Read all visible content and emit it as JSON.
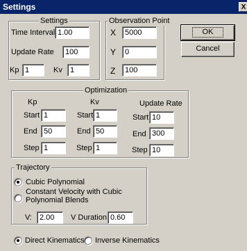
{
  "window": {
    "title": "Settings",
    "close_glyph": "X"
  },
  "buttons": {
    "ok": "OK",
    "cancel": "Cancel"
  },
  "settings": {
    "legend": "Settings",
    "time_interval_label": "Time Interval",
    "time_interval": "1.00",
    "update_rate_label": "Update Rate",
    "update_rate": "100",
    "kp_label": "Kp",
    "kp": "1",
    "kv_label": "Kv",
    "kv": "1"
  },
  "observation": {
    "legend": "Observation Point",
    "x_label": "X",
    "x": "5000",
    "y_label": "Y",
    "y": "0",
    "z_label": "Z",
    "z": "100"
  },
  "optimization": {
    "legend": "Optimization",
    "columns": [
      {
        "header": "Kp",
        "start": "1",
        "end": "50",
        "step": "1"
      },
      {
        "header": "Kv",
        "start": "1",
        "end": "50",
        "step": "1"
      },
      {
        "header": "Update Rate",
        "start": "10",
        "end": "300",
        "step": "10"
      }
    ],
    "start_label": "Start",
    "end_label": "End",
    "step_label": "Step"
  },
  "trajectory": {
    "legend": "Trajectory",
    "cubic_label": "Cubic Polynomial",
    "const_label_line1": "Constant Velocity with Cubic",
    "const_label_line2": "Polynomial Blends",
    "selected": "Cubic Polynomial",
    "v_label": "V:",
    "v": "2.00",
    "v_duration_label": "V Duration:",
    "v_duration": "0.60"
  },
  "kinematics": {
    "direct_label": "Direct Kinematics",
    "inverse_label": "Inverse Kinematics",
    "selected": "Direct Kinematics"
  }
}
